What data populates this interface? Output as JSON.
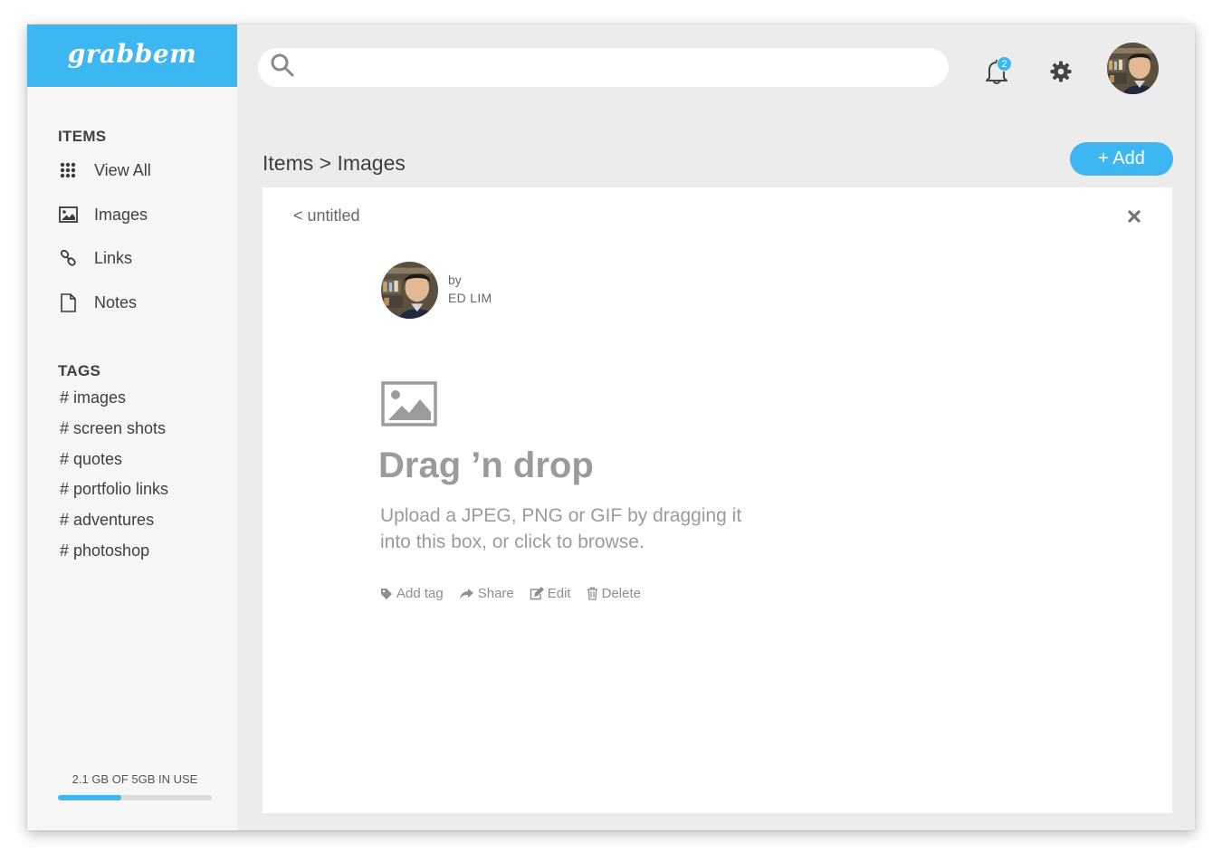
{
  "app": {
    "logo": "grabbem",
    "brand_color": "#3cb7f2"
  },
  "sidebar": {
    "items_heading": "ITEMS",
    "items": [
      {
        "label": "View All",
        "icon": "grid-icon"
      },
      {
        "label": "Images",
        "icon": "image-icon"
      },
      {
        "label": "Links",
        "icon": "link-icon"
      },
      {
        "label": "Notes",
        "icon": "note-icon"
      }
    ],
    "tags_heading": "TAGS",
    "tags": [
      "# images",
      "# screen shots",
      "# quotes",
      "# portfolio links",
      "# adventures",
      "# photoshop"
    ],
    "storage": {
      "label": "2.1 GB OF 5GB IN USE",
      "used_fraction": 0.41
    }
  },
  "topbar": {
    "search_placeholder": "",
    "notification_count": "2",
    "icons": [
      "search-icon",
      "bell-icon",
      "gear-icon",
      "avatar"
    ]
  },
  "main": {
    "breadcrumb": "Items > Images",
    "add_button": "+ Add",
    "card": {
      "back_label": "<  untitled",
      "by_label": "by",
      "author": "ED LIM",
      "dropzone_title": "Drag ’n drop",
      "dropzone_description": "Upload a JPEG, PNG or GIF by dragging it into this box, or click to browse.",
      "actions": [
        {
          "label": "Add tag",
          "icon": "tag-icon"
        },
        {
          "label": "Share",
          "icon": "share-icon"
        },
        {
          "label": "Edit",
          "icon": "edit-icon"
        },
        {
          "label": "Delete",
          "icon": "trash-icon"
        }
      ]
    }
  }
}
